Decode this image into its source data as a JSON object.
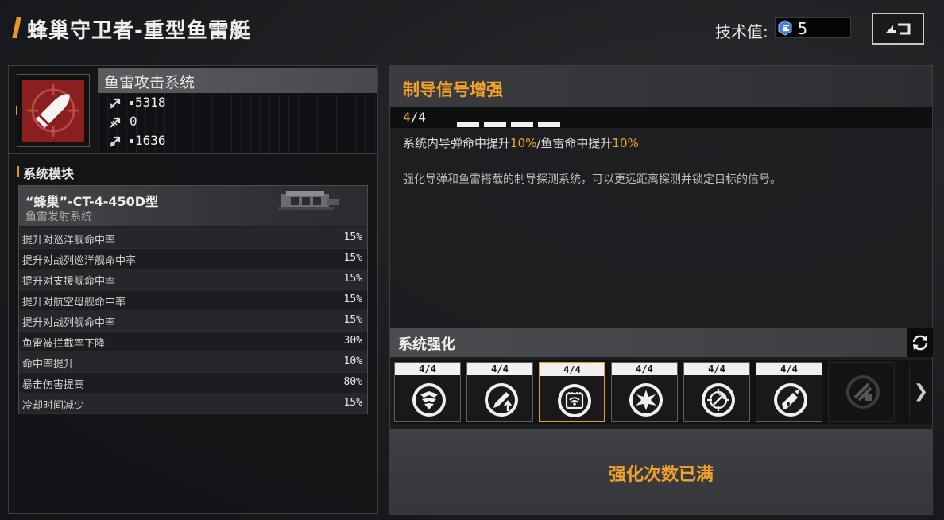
{
  "header": {
    "title": "蜂巢守卫者-重型鱼雷艇",
    "tech_label": "技术值:",
    "tech_value": "5"
  },
  "system": {
    "name": "鱼雷攻击系统",
    "stats": [
      {
        "icon": "attack-arrow-icon",
        "value": "5318"
      },
      {
        "icon": "penetration-arrow-icon",
        "value": "0"
      },
      {
        "icon": "siege-arrow-icon",
        "value": "1636"
      }
    ]
  },
  "modules": {
    "section_title": "系统模块",
    "card": {
      "name": "“蜂巢”-CT-4-450D型",
      "subtitle": "鱼雷发射系统",
      "rows": [
        {
          "label": "提升对巡洋舰命中率",
          "value": "15%"
        },
        {
          "label": "提升对战列巡洋舰命中率",
          "value": "15%"
        },
        {
          "label": "提升对支援舰命中率",
          "value": "15%"
        },
        {
          "label": "提升对航空母舰命中率",
          "value": "15%"
        },
        {
          "label": "提升对战列舰命中率",
          "value": "15%"
        },
        {
          "label": "鱼雷被拦截率下降",
          "value": "30%"
        },
        {
          "label": "命中率提升",
          "value": "10%"
        },
        {
          "label": "暴击伤害提高",
          "value": "80%"
        },
        {
          "label": "冷却时间减少",
          "value": "15%"
        }
      ]
    }
  },
  "detail": {
    "title": "制导信号增强",
    "level_current": "4",
    "level_total": "/4",
    "pips": 4,
    "effect_a": "系统内导弹命中提升",
    "effect_a_val": "10%",
    "effect_b": "/鱼雷命中提升",
    "effect_b_val": "10%",
    "description": "强化导弹和鱼雷搭载的制导探测系统，可以更远距离探测并锁定目标的信号。"
  },
  "enhance": {
    "title": "系统强化",
    "slots": [
      {
        "level": "4/4",
        "icon": "shield-wings-icon",
        "selected": false
      },
      {
        "level": "4/4",
        "icon": "pencil-up-icon",
        "selected": false
      },
      {
        "level": "4/4",
        "icon": "signal-chip-icon",
        "selected": true
      },
      {
        "level": "4/4",
        "icon": "explosion-icon",
        "selected": false
      },
      {
        "level": "4/4",
        "icon": "crosshair-missile-icon",
        "selected": false
      },
      {
        "level": "4/4",
        "icon": "rocket-launch-icon",
        "selected": false
      },
      {
        "level": "",
        "icon": "locked-wrench-icon",
        "selected": false
      }
    ],
    "next_arrow": "❯",
    "maxed_text": "强化次数已满"
  },
  "colors": {
    "accent": "#f2a12a",
    "icon_red": "#8b1e1e"
  }
}
